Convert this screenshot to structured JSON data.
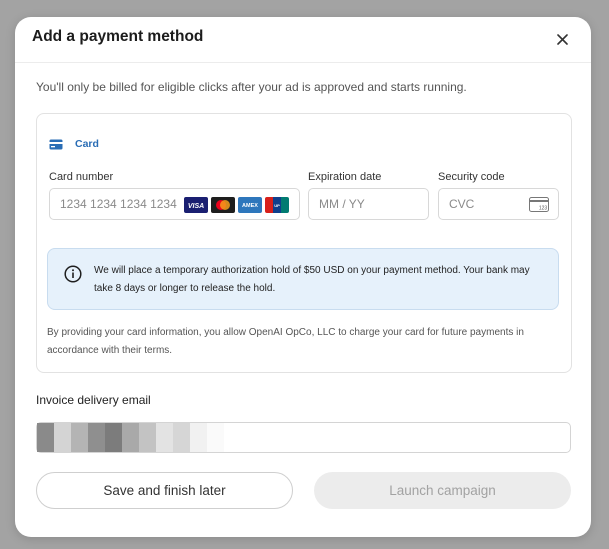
{
  "modal": {
    "title": "Add a payment method",
    "close_icon": "close-icon",
    "subtitle": "You'll only be billed for eligible clicks after your ad is approved and starts running."
  },
  "payment": {
    "tab_label": "Card",
    "tab_icon": "credit-card-icon",
    "card_number": {
      "label": "Card number",
      "placeholder": "1234 1234 1234 1234"
    },
    "brands": [
      "VISA",
      "Mastercard",
      "AMEX",
      "UnionPay"
    ],
    "expiration": {
      "label": "Expiration date",
      "placeholder": "MM / YY"
    },
    "security": {
      "label": "Security code",
      "placeholder": "CVC",
      "icon_text": "123"
    },
    "notice": "We will place a temporary authorization hold of $50 USD on your payment method. Your bank may take 8 days or longer to release the hold.",
    "notice_icon": "info-icon",
    "legal": "By providing your card information, you allow OpenAI OpCo, LLC to charge your card for future payments in accordance with their terms."
  },
  "invoice": {
    "label": "Invoice delivery email"
  },
  "actions": {
    "secondary": "Save and finish later",
    "primary": "Launch campaign"
  },
  "colors": {
    "accent": "#2a6db5",
    "notice_bg": "#e6f1fb",
    "disabled_bg": "#ececec"
  }
}
